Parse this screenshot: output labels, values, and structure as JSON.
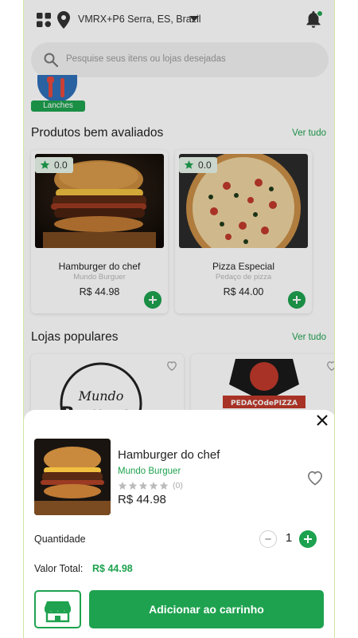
{
  "header": {
    "address": "VMRX+P6 Serra, ES, Brazil"
  },
  "search": {
    "placeholder": "Pesquise seus itens ou lojas desejadas"
  },
  "category": {
    "label": "Lanches"
  },
  "sections": {
    "top_rated": {
      "title": "Produtos bem avaliados",
      "see_all": "Ver tudo"
    },
    "popular_stores": {
      "title": "Lojas populares",
      "see_all": "Ver tudo"
    }
  },
  "products": [
    {
      "rating": "0.0",
      "name": "Hamburger do chef",
      "store": "Mundo Burguer",
      "price": "R$ 44.98"
    },
    {
      "rating": "0.0",
      "name": "Pizza Especial",
      "store": "Pedaço de pizza",
      "price": "R$ 44.00"
    }
  ],
  "stores": [
    {
      "logo_text": "Burguer"
    },
    {
      "logo_text": "PEDAÇOdePIZZA"
    }
  ],
  "sheet": {
    "name": "Hamburger do chef",
    "store": "Mundo Burguer",
    "rating_stars": 0,
    "review_count": "(0)",
    "price": "R$ 44.98",
    "quantity_label": "Quantidade",
    "quantity": "1",
    "total_label": "Valor Total:",
    "total_value": "R$ 44.98",
    "add_to_cart": "Adicionar ao carrinho"
  },
  "colors": {
    "accent": "#1ea24f",
    "overlay": "rgba(0,0,0,0.12)"
  },
  "icons": [
    "grid-icon",
    "location-pin-icon",
    "caret-down-icon",
    "bell-icon",
    "search-icon",
    "star-icon",
    "plus-icon",
    "heart-icon",
    "close-icon",
    "minus-icon",
    "storefront-icon"
  ]
}
